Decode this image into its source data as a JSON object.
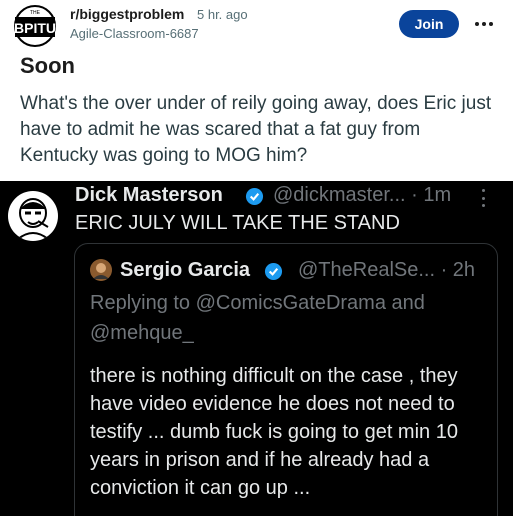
{
  "post": {
    "subreddit": "r/biggestproblem",
    "age": "5 hr. ago",
    "author": "Agile-Classroom-6687",
    "join_label": "Join",
    "title": "Soon",
    "body": "What's the over under of reily going away, does Eric just have to admit he was scared that a fat guy from Kentucky was going to MOG him?",
    "avatar_text": "BPITU"
  },
  "tweet": {
    "name": "Dick Masterson",
    "handle_time": "@dickmaster... · 1m",
    "text": "ERIC JULY WILL TAKE THE STAND",
    "quote": {
      "name": "Sergio Garcia",
      "handle_time": "@TheRealSe... · 2h",
      "reply_line": "Replying to @ComicsGateDrama and @mehque_",
      "body": "there is nothing difficult on the case , they have video evidence he does not need to testify ... dumb fuck is going to get min 10 years in prison and if he already had a conviction it can go up ..."
    }
  },
  "colors": {
    "join_button": "#0a449b",
    "verified_badge": "#1d9bf0"
  },
  "icons": [
    "subreddit-avatar-icon",
    "more-options-icon",
    "verified-badge-icon"
  ]
}
